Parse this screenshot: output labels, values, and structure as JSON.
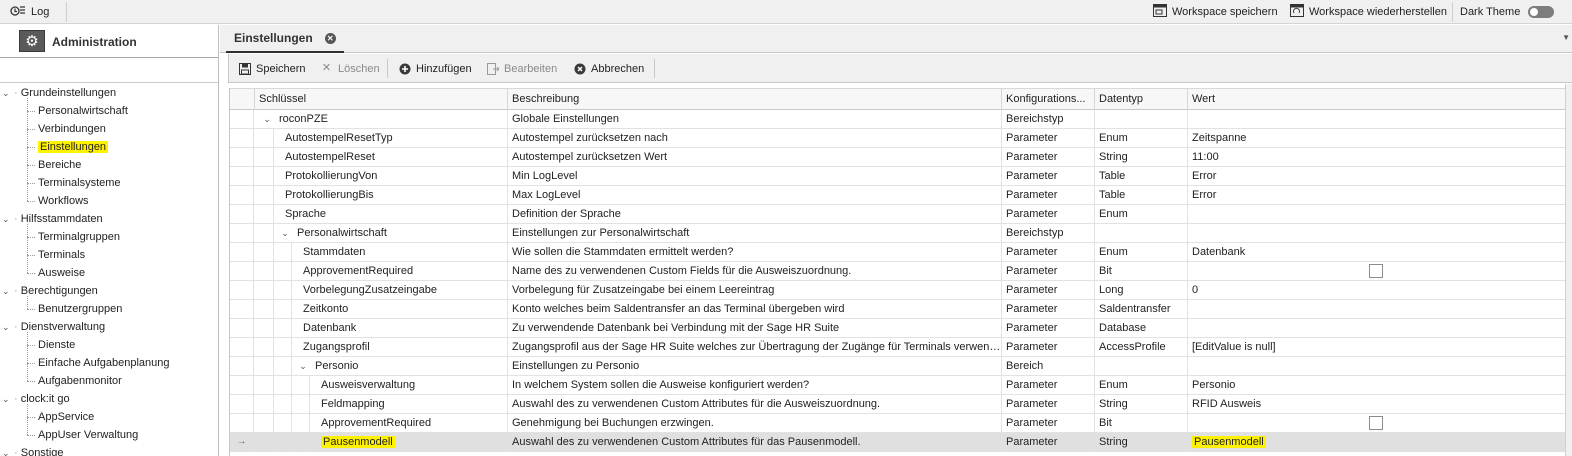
{
  "topbar": {
    "log_label": "Log",
    "workspace_save_label": "Workspace speichern",
    "workspace_restore_label": "Workspace wiederherstellen",
    "dark_theme_label": "Dark Theme",
    "dark_theme_on": false
  },
  "left_panel": {
    "title": "Administration",
    "tree": [
      {
        "label": "Grundeinstellungen",
        "level": 0,
        "expanded": true
      },
      {
        "label": "Personalwirtschaft",
        "level": 1
      },
      {
        "label": "Verbindungen",
        "level": 1
      },
      {
        "label": "Einstellungen",
        "level": 1,
        "highlighted": true
      },
      {
        "label": "Bereiche",
        "level": 1
      },
      {
        "label": "Terminalsysteme",
        "level": 1
      },
      {
        "label": "Workflows",
        "level": 1
      },
      {
        "label": "Hilfsstammdaten",
        "level": 0,
        "expanded": true
      },
      {
        "label": "Terminalgruppen",
        "level": 1
      },
      {
        "label": "Terminals",
        "level": 1
      },
      {
        "label": "Ausweise",
        "level": 1
      },
      {
        "label": "Berechtigungen",
        "level": 0,
        "expanded": true
      },
      {
        "label": "Benutzergruppen",
        "level": 1
      },
      {
        "label": "Dienstverwaltung",
        "level": 0,
        "expanded": true
      },
      {
        "label": "Dienste",
        "level": 1
      },
      {
        "label": "Einfache Aufgabenplanung",
        "level": 1
      },
      {
        "label": "Aufgabenmonitor",
        "level": 1
      },
      {
        "label": "clock:it go",
        "level": 0,
        "expanded": true
      },
      {
        "label": "AppService",
        "level": 1
      },
      {
        "label": "AppUser Verwaltung",
        "level": 1
      },
      {
        "label": "Sonstige",
        "level": 0,
        "expanded": true
      }
    ]
  },
  "tab": {
    "label": "Einstellungen"
  },
  "toolbar": {
    "save": "Speichern",
    "delete": "Löschen",
    "add": "Hinzufügen",
    "edit": "Bearbeiten",
    "cancel": "Abbrechen"
  },
  "grid": {
    "columns": [
      "Schlüssel",
      "Beschreibung",
      "Konfigurations...",
      "Datentyp",
      "Wert"
    ],
    "rows": [
      {
        "key": "roconPZE",
        "desc": "Globale Einstellungen",
        "conf": "Bereichstyp",
        "type": "",
        "value": "",
        "level": 0,
        "expander": "v"
      },
      {
        "key": "AutostempelResetTyp",
        "desc": "Autostempel zurücksetzen nach",
        "conf": "Parameter",
        "type": "Enum",
        "value": "Zeitspanne",
        "level": 1
      },
      {
        "key": "AutostempelReset",
        "desc": "Autostempel zurücksetzen Wert",
        "conf": "Parameter",
        "type": "String",
        "value": "11:00",
        "level": 1
      },
      {
        "key": "ProtokollierungVon",
        "desc": "Min LogLevel",
        "conf": "Parameter",
        "type": "Table",
        "value": "Error",
        "level": 1
      },
      {
        "key": "ProtokollierungBis",
        "desc": "Max LogLevel",
        "conf": "Parameter",
        "type": "Table",
        "value": "Error",
        "level": 1
      },
      {
        "key": "Sprache",
        "desc": "Definition der Sprache",
        "conf": "Parameter",
        "type": "Enum",
        "value": "",
        "level": 1
      },
      {
        "key": "Personalwirtschaft",
        "desc": "Einstellungen zur Personalwirtschaft",
        "conf": "Bereichstyp",
        "type": "",
        "value": "",
        "level": 1,
        "expander": "v"
      },
      {
        "key": "Stammdaten",
        "desc": "Wie sollen die Stammdaten ermittelt werden?",
        "conf": "Parameter",
        "type": "Enum",
        "value": "Datenbank",
        "level": 2
      },
      {
        "key": "ApprovementRequired",
        "desc": "Name des zu verwendenen Custom Fields für die Ausweiszuordnung.",
        "conf": "Parameter",
        "type": "Bit",
        "value": "",
        "checkbox": true,
        "level": 2
      },
      {
        "key": "VorbelegungZusatzeingabe",
        "desc": "Vorbelegung für Zusatzeingabe bei einem Leereintrag",
        "conf": "Parameter",
        "type": "Long",
        "value": "0",
        "level": 2
      },
      {
        "key": "Zeitkonto",
        "desc": "Konto welches beim Saldentransfer an das Terminal übergeben wird",
        "conf": "Parameter",
        "type": "Saldentransfer",
        "value": "",
        "level": 2
      },
      {
        "key": "Datenbank",
        "desc": "Zu verwendende Datenbank bei Verbindung mit der Sage HR Suite",
        "conf": "Parameter",
        "type": "Database",
        "value": "",
        "level": 2
      },
      {
        "key": "Zugangsprofil",
        "desc": "Zugangsprofil aus der Sage HR Suite welches zur Übertragung der Zugänge für Terminals verwend...",
        "conf": "Parameter",
        "type": "AccessProfile",
        "value": "[EditValue is null]",
        "level": 2
      },
      {
        "key": "Personio",
        "desc": "Einstellungen zu Personio",
        "conf": "Bereich",
        "type": "",
        "value": "",
        "level": 2,
        "expander": "v"
      },
      {
        "key": "Ausweisverwaltung",
        "desc": "In welchem System sollen die Ausweise konfiguriert werden?",
        "conf": "Parameter",
        "type": "Enum",
        "value": "Personio",
        "level": 3
      },
      {
        "key": "Feldmapping",
        "desc": "Auswahl des zu verwendenen Custom Attributes für die Ausweiszuordnung.",
        "conf": "Parameter",
        "type": "String",
        "value": "RFID Ausweis",
        "level": 3
      },
      {
        "key": "ApprovementRequired",
        "desc": "Genehmigung bei Buchungen erzwingen.",
        "conf": "Parameter",
        "type": "Bit",
        "value": "",
        "checkbox": true,
        "level": 3
      },
      {
        "key": "Pausenmodell",
        "desc": "Auswahl des zu verwendenen Custom Attributes für das Pausenmodell.",
        "conf": "Parameter",
        "type": "String",
        "value": "Pausenmodell",
        "level": 3,
        "selected": true,
        "highlight": true,
        "indicator": "→"
      }
    ]
  }
}
